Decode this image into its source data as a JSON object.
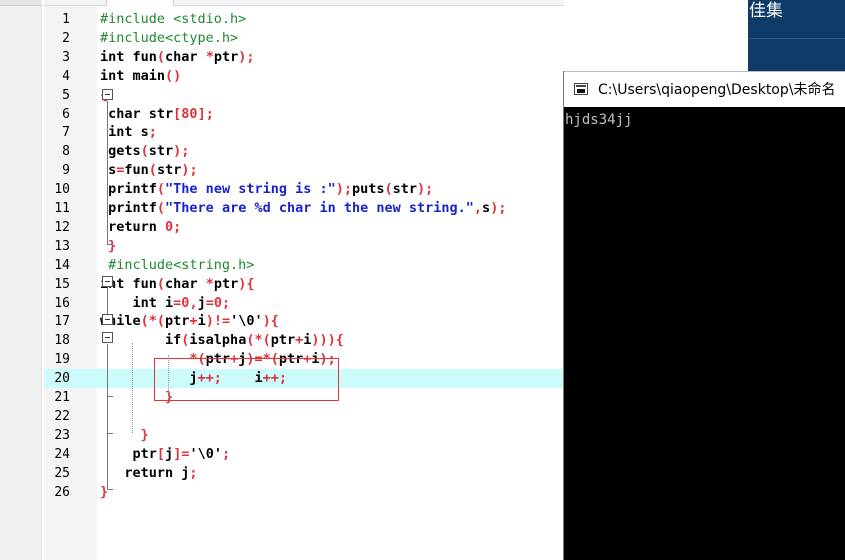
{
  "background_window": {
    "title_fragment": "佳集"
  },
  "editor": {
    "lines": [
      {
        "n": "1",
        "tokens": [
          {
            "t": "#include <stdio.h>",
            "c": "pp"
          }
        ]
      },
      {
        "n": "2",
        "tokens": [
          {
            "t": "#include<ctype.h>",
            "c": "pp"
          }
        ]
      },
      {
        "n": "3",
        "tokens": [
          {
            "t": "int fun",
            "c": "kw"
          },
          {
            "t": "(",
            "c": "op"
          },
          {
            "t": "char ",
            "c": "kw"
          },
          {
            "t": "*",
            "c": "op"
          },
          {
            "t": "ptr",
            "c": "id"
          },
          {
            "t": ");",
            "c": "op"
          }
        ]
      },
      {
        "n": "4",
        "tokens": [
          {
            "t": "int main",
            "c": "kw"
          },
          {
            "t": "()",
            "c": "op"
          }
        ]
      },
      {
        "n": "5",
        "tokens": [
          {
            "t": "{",
            "c": "op"
          }
        ]
      },
      {
        "n": "6",
        "tokens": [
          {
            "t": " char str",
            "c": "kw"
          },
          {
            "t": "[",
            "c": "op"
          },
          {
            "t": "80",
            "c": "num"
          },
          {
            "t": "];",
            "c": "op"
          }
        ]
      },
      {
        "n": "7",
        "tokens": [
          {
            "t": " int s",
            "c": "kw"
          },
          {
            "t": ";",
            "c": "op"
          }
        ]
      },
      {
        "n": "8",
        "tokens": [
          {
            "t": " gets",
            "c": "kw"
          },
          {
            "t": "(",
            "c": "op"
          },
          {
            "t": "str",
            "c": "id"
          },
          {
            "t": ");",
            "c": "op"
          }
        ]
      },
      {
        "n": "9",
        "tokens": [
          {
            "t": " s",
            "c": "kw"
          },
          {
            "t": "=",
            "c": "op"
          },
          {
            "t": "fun",
            "c": "id"
          },
          {
            "t": "(",
            "c": "op"
          },
          {
            "t": "str",
            "c": "id"
          },
          {
            "t": ");",
            "c": "op"
          }
        ]
      },
      {
        "n": "10",
        "tokens": [
          {
            "t": " printf",
            "c": "kw"
          },
          {
            "t": "(",
            "c": "op"
          },
          {
            "t": "\"The new string is :\"",
            "c": "str"
          },
          {
            "t": ");",
            "c": "op"
          },
          {
            "t": "puts",
            "c": "id"
          },
          {
            "t": "(",
            "c": "op"
          },
          {
            "t": "str",
            "c": "id"
          },
          {
            "t": ");",
            "c": "op"
          }
        ]
      },
      {
        "n": "11",
        "tokens": [
          {
            "t": " printf",
            "c": "kw"
          },
          {
            "t": "(",
            "c": "op"
          },
          {
            "t": "\"There are %d char in the new string.\"",
            "c": "str"
          },
          {
            "t": ",",
            "c": "op"
          },
          {
            "t": "s",
            "c": "id"
          },
          {
            "t": ");",
            "c": "op"
          }
        ]
      },
      {
        "n": "12",
        "tokens": [
          {
            "t": " return ",
            "c": "kw"
          },
          {
            "t": "0",
            "c": "num"
          },
          {
            "t": ";",
            "c": "op"
          }
        ]
      },
      {
        "n": "13",
        "tokens": [
          {
            "t": " }",
            "c": "op"
          }
        ]
      },
      {
        "n": "14",
        "tokens": [
          {
            "t": " #include<string.h>",
            "c": "pp"
          }
        ]
      },
      {
        "n": "15",
        "tokens": [
          {
            "t": "int fun",
            "c": "kw"
          },
          {
            "t": "(",
            "c": "op"
          },
          {
            "t": "char ",
            "c": "kw"
          },
          {
            "t": "*",
            "c": "op"
          },
          {
            "t": "ptr",
            "c": "id"
          },
          {
            "t": "){",
            "c": "op"
          }
        ]
      },
      {
        "n": "16",
        "tokens": [
          {
            "t": "    int i",
            "c": "kw"
          },
          {
            "t": "=",
            "c": "op"
          },
          {
            "t": "0",
            "c": "num"
          },
          {
            "t": ",",
            "c": "op"
          },
          {
            "t": "j",
            "c": "id"
          },
          {
            "t": "=",
            "c": "op"
          },
          {
            "t": "0",
            "c": "num"
          },
          {
            "t": ";",
            "c": "op"
          }
        ]
      },
      {
        "n": "17",
        "tokens": [
          {
            "t": "while",
            "c": "kw"
          },
          {
            "t": "(*(",
            "c": "op"
          },
          {
            "t": "ptr",
            "c": "id"
          },
          {
            "t": "+",
            "c": "op"
          },
          {
            "t": "i",
            "c": "id"
          },
          {
            "t": ")!=",
            "c": "op"
          },
          {
            "t": "'\\0'",
            "c": "id"
          },
          {
            "t": "){",
            "c": "op"
          }
        ]
      },
      {
        "n": "18",
        "tokens": [
          {
            "t": "        if",
            "c": "kw"
          },
          {
            "t": "(",
            "c": "op"
          },
          {
            "t": "isalpha",
            "c": "id"
          },
          {
            "t": "(*(",
            "c": "op"
          },
          {
            "t": "ptr",
            "c": "id"
          },
          {
            "t": "+",
            "c": "op"
          },
          {
            "t": "i",
            "c": "id"
          },
          {
            "t": "))){",
            "c": "op"
          }
        ]
      },
      {
        "n": "19",
        "tokens": [
          {
            "t": "           *(",
            "c": "op"
          },
          {
            "t": "ptr",
            "c": "id"
          },
          {
            "t": "+",
            "c": "op"
          },
          {
            "t": "j",
            "c": "id"
          },
          {
            "t": ")=*(",
            "c": "op"
          },
          {
            "t": "ptr",
            "c": "id"
          },
          {
            "t": "+",
            "c": "op"
          },
          {
            "t": "i",
            "c": "id"
          },
          {
            "t": ");",
            "c": "op"
          }
        ]
      },
      {
        "n": "20",
        "tokens": [
          {
            "t": "           j",
            "c": "kw"
          },
          {
            "t": "++;",
            "c": "op"
          },
          {
            "t": "    i",
            "c": "id"
          },
          {
            "t": "++;",
            "c": "op"
          }
        ]
      },
      {
        "n": "21",
        "tokens": [
          {
            "t": "        }",
            "c": "op"
          }
        ]
      },
      {
        "n": "22",
        "tokens": []
      },
      {
        "n": "23",
        "tokens": [
          {
            "t": "     }",
            "c": "op"
          }
        ]
      },
      {
        "n": "24",
        "tokens": [
          {
            "t": "    ptr",
            "c": "kw"
          },
          {
            "t": "[",
            "c": "op"
          },
          {
            "t": "j",
            "c": "id"
          },
          {
            "t": "]=",
            "c": "op"
          },
          {
            "t": "'\\0'",
            "c": "id"
          },
          {
            "t": ";",
            "c": "op"
          }
        ]
      },
      {
        "n": "25",
        "tokens": [
          {
            "t": "   return j",
            "c": "kw"
          },
          {
            "t": ";",
            "c": "op"
          }
        ]
      },
      {
        "n": "26",
        "tokens": [
          {
            "t": "}",
            "c": "op"
          }
        ]
      }
    ]
  },
  "console": {
    "title": "C:\\Users\\qiaopeng\\Desktop\\未命名",
    "output": "hjds34jj"
  },
  "colors": {
    "preprocessor": "#1f8a2f",
    "string": "#1b22c9",
    "operator": "#e0313b",
    "highlight_line": "#ccfbfb",
    "annotation_box": "#e03535",
    "console_bg": "#000000",
    "background_window": "#0d3a66"
  },
  "icons": [
    "fold-minus-icon",
    "console-window-icon"
  ]
}
